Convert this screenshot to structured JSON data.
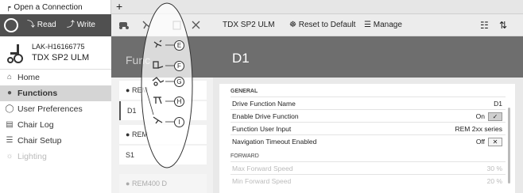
{
  "tab": {
    "label": "Open a Connection",
    "add": "+"
  },
  "toolbar": {
    "read": "Read",
    "write": "Write",
    "device_title": "TDX SP2 ULM",
    "reset": "Reset to Default",
    "manage": "Manage"
  },
  "device": {
    "id": "LAK-H16166775",
    "name": "TDX SP2 ULM"
  },
  "nav": {
    "items": [
      {
        "label": "Home",
        "icon": "home-icon"
      },
      {
        "label": "Functions",
        "icon": "functions-icon"
      },
      {
        "label": "User Preferences",
        "icon": "user-icon"
      },
      {
        "label": "Chair Log",
        "icon": "log-icon"
      },
      {
        "label": "Chair Setup",
        "icon": "setup-icon"
      },
      {
        "label": "Lighting",
        "icon": "lighting-icon"
      }
    ]
  },
  "functions": {
    "header": "Func",
    "items": [
      "REM",
      "D1",
      "REM",
      "S1",
      "REM400 D"
    ]
  },
  "detail": {
    "title": "D1",
    "sections": {
      "general": "GENERAL",
      "forward": "FORWARD"
    },
    "rows": [
      {
        "label": "Drive Function Name",
        "value": "D1"
      },
      {
        "label": "Enable Drive Function",
        "value": "On"
      },
      {
        "label": "Function User Input",
        "value": "REM 2xx series"
      },
      {
        "label": "Navigation Timeout Enabled",
        "value": "Off"
      },
      {
        "label": "Max Forward Speed",
        "value": "30 %"
      },
      {
        "label": "Min Forward Speed",
        "value": "20 %"
      }
    ]
  },
  "callouts": [
    "E",
    "F",
    "G",
    "H",
    "I"
  ]
}
